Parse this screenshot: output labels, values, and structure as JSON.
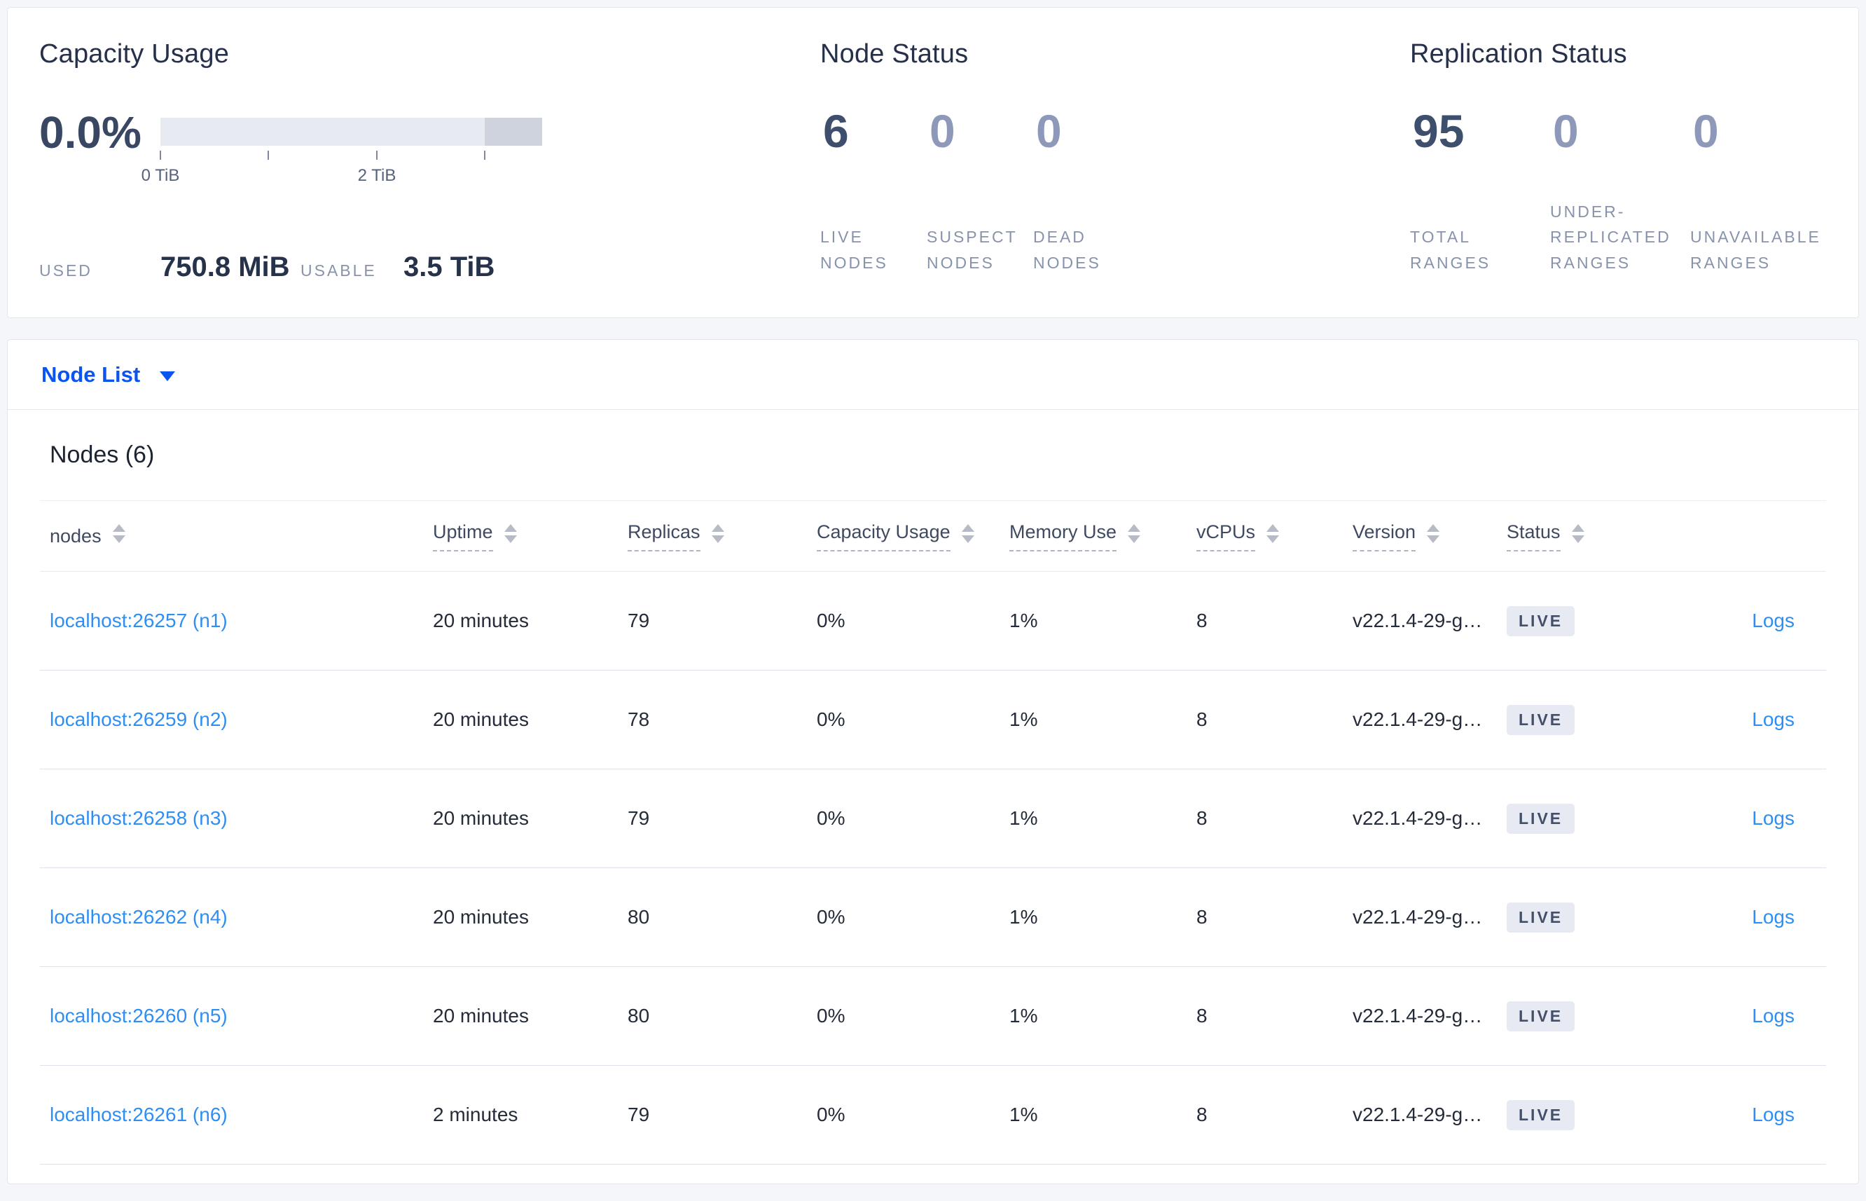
{
  "summary": {
    "capacity": {
      "title": "Capacity Usage",
      "percent": "0.0%",
      "bar": {
        "light_fraction": 0.85,
        "dark_fraction": 0.15,
        "tick_positions_pct": [
          0,
          28.3,
          56.7,
          85
        ]
      },
      "tick_label_start": "0 TiB",
      "tick_label_mid": "2 TiB",
      "used_label": "USED",
      "used_value": "750.8 MiB",
      "usable_label": "USABLE",
      "usable_value": "3.5 TiB"
    },
    "node_status": {
      "title": "Node Status",
      "stats": [
        {
          "value": "6",
          "label": "LIVE NODES"
        },
        {
          "value": "0",
          "label": "SUSPECT NODES"
        },
        {
          "value": "0",
          "label": "DEAD NODES"
        }
      ]
    },
    "replication": {
      "title": "Replication Status",
      "stats": [
        {
          "value": "95",
          "label": "TOTAL RANGES"
        },
        {
          "value": "0",
          "label": "UNDER-REPLICATED RANGES"
        },
        {
          "value": "0",
          "label": "UNAVAILABLE RANGES"
        }
      ]
    }
  },
  "node_list": {
    "dropdown_label": "Node List",
    "section_title": "Nodes (6)",
    "columns": [
      {
        "label": "nodes"
      },
      {
        "label": "Uptime"
      },
      {
        "label": "Replicas"
      },
      {
        "label": "Capacity Usage"
      },
      {
        "label": "Memory Use"
      },
      {
        "label": "vCPUs"
      },
      {
        "label": "Version"
      },
      {
        "label": "Status"
      }
    ],
    "rows": [
      {
        "addr": "localhost:26257 (n1)",
        "uptime": "20 minutes",
        "replicas": "79",
        "capacity": "0%",
        "memory": "1%",
        "vcpus": "8",
        "version": "v22.1.4-29-g…",
        "status": "LIVE",
        "logs": "Logs"
      },
      {
        "addr": "localhost:26259 (n2)",
        "uptime": "20 minutes",
        "replicas": "78",
        "capacity": "0%",
        "memory": "1%",
        "vcpus": "8",
        "version": "v22.1.4-29-g…",
        "status": "LIVE",
        "logs": "Logs"
      },
      {
        "addr": "localhost:26258 (n3)",
        "uptime": "20 minutes",
        "replicas": "79",
        "capacity": "0%",
        "memory": "1%",
        "vcpus": "8",
        "version": "v22.1.4-29-g…",
        "status": "LIVE",
        "logs": "Logs"
      },
      {
        "addr": "localhost:26262 (n4)",
        "uptime": "20 minutes",
        "replicas": "80",
        "capacity": "0%",
        "memory": "1%",
        "vcpus": "8",
        "version": "v22.1.4-29-g…",
        "status": "LIVE",
        "logs": "Logs"
      },
      {
        "addr": "localhost:26260 (n5)",
        "uptime": "20 minutes",
        "replicas": "80",
        "capacity": "0%",
        "memory": "1%",
        "vcpus": "8",
        "version": "v22.1.4-29-g…",
        "status": "LIVE",
        "logs": "Logs"
      },
      {
        "addr": "localhost:26261 (n6)",
        "uptime": "2 minutes",
        "replicas": "79",
        "capacity": "0%",
        "memory": "1%",
        "vcpus": "8",
        "version": "v22.1.4-29-g…",
        "status": "LIVE",
        "logs": "Logs"
      }
    ]
  },
  "icons": {
    "node_list_dropdown": "chevron-down",
    "column_sort": "sort-arrows"
  },
  "colors": {
    "accent_blue": "#0a55f0",
    "link_blue": "#2f8ef2",
    "badge_bg": "#e7eaf2",
    "bar_light": "#e8eaf1",
    "bar_dark": "#ced3de",
    "number_dark": "#3e4e6d",
    "number_muted": "#8e99ba",
    "page_bg": "#f4f6f9"
  }
}
